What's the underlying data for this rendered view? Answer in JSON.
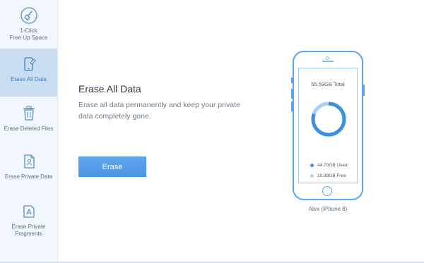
{
  "sidebar": {
    "items": [
      {
        "label": "1-Click\nFree Up Space",
        "icon": "broom-icon",
        "active": false
      },
      {
        "label": "Erase All Data",
        "icon": "phone-erase-icon",
        "active": true
      },
      {
        "label": "Erase Deleted Files",
        "icon": "trash-icon",
        "active": false
      },
      {
        "label": "Erase Private Data",
        "icon": "private-file-icon",
        "active": false
      },
      {
        "label": "Erase Private\nFragments",
        "icon": "app-fragments-icon",
        "active": false
      }
    ]
  },
  "main": {
    "title": "Erase All Data",
    "description": "Erase all data permanently and keep your private data completely gone.",
    "erase_label": "Erase"
  },
  "device": {
    "total": "55.59GB Total",
    "used_label": "44.70GB Used",
    "free_label": "10.89GB Free",
    "used_gb": 44.7,
    "free_gb": 10.89,
    "used_color": "#3d8fe0",
    "free_color": "#a9d0f4",
    "name": "Alex (iPhone 8)"
  },
  "colors": {
    "accent": "#4a95e2",
    "sidebar_active": "#c9def0"
  }
}
